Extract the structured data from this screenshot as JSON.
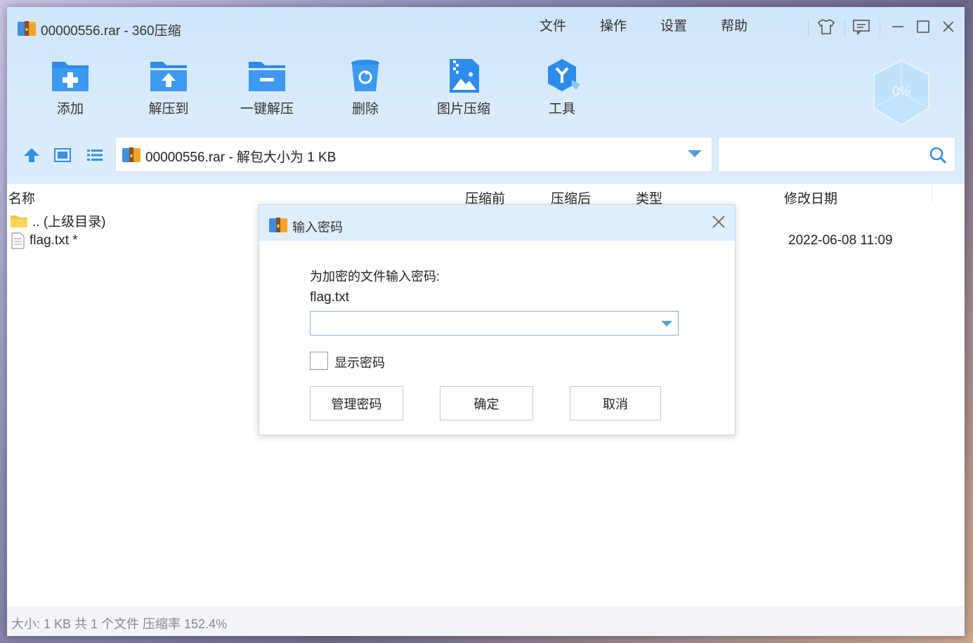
{
  "window": {
    "title": "00000556.rar - 360压缩",
    "menu": [
      "文件",
      "操作",
      "设置",
      "帮助"
    ]
  },
  "toolbar": {
    "buttons": [
      {
        "label": "添加",
        "icon": "add-folder-icon"
      },
      {
        "label": "解压到",
        "icon": "extract-to-icon"
      },
      {
        "label": "一键解压",
        "icon": "one-click-extract-icon"
      },
      {
        "label": "删除",
        "icon": "trash-icon"
      },
      {
        "label": "图片压缩",
        "icon": "image-compress-icon"
      },
      {
        "label": "工具",
        "icon": "tools-icon"
      }
    ],
    "progress_badge": "0%"
  },
  "address": {
    "text": "00000556.rar - 解包大小为 1 KB"
  },
  "search": {
    "placeholder": ""
  },
  "file_list": {
    "columns": [
      "名称",
      "压缩前",
      "压缩后",
      "类型",
      "修改日期"
    ],
    "rows": [
      {
        "name": ".. (上级目录)",
        "icon": "folder-icon",
        "size_before": "",
        "size_after": "",
        "type": "",
        "modified": ""
      },
      {
        "name": "flag.txt *",
        "icon": "text-file-icon",
        "size_before": "",
        "size_after": "",
        "type": "",
        "modified": "2022-06-08 11:09"
      }
    ]
  },
  "statusbar": {
    "text": "大小: 1 KB 共 1 个文件 压缩率 152.4%"
  },
  "dialog": {
    "title": "输入密码",
    "prompt": "为加密的文件输入密码:",
    "filename": "flag.txt",
    "password_value": "",
    "show_password_label": "显示密码",
    "show_password_checked": false,
    "buttons": {
      "manage": "管理密码",
      "ok": "确定",
      "cancel": "取消"
    }
  },
  "colors": {
    "accent": "#2d8ceb",
    "toolbar_bg": "#d9ebfc",
    "dialog_header_bg": "#dfeefb"
  }
}
